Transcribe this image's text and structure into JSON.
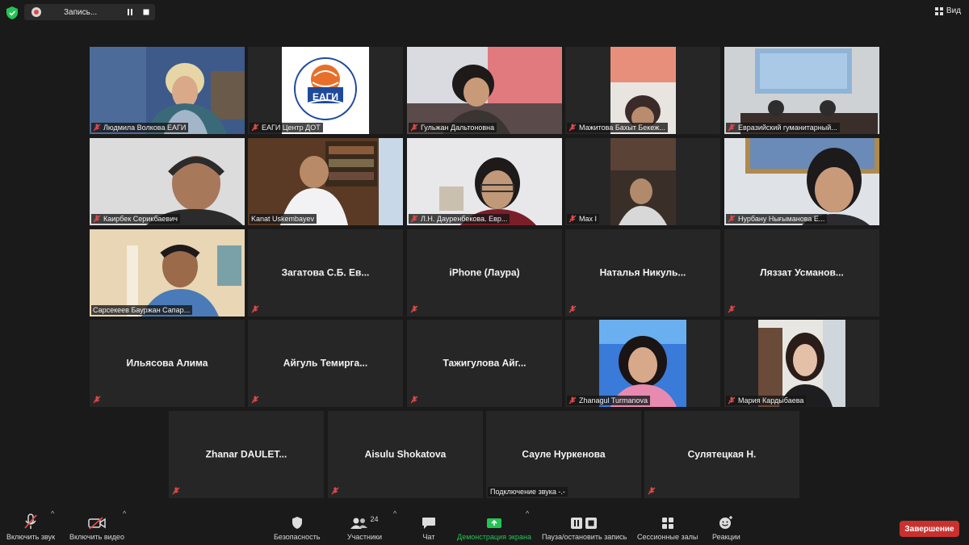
{
  "window": {
    "recording_label": "Запись...",
    "view_label": "Вид"
  },
  "participants": [
    {
      "name": "Людмила Волкова ЕАГИ",
      "video": true
    },
    {
      "name": "ЕАГИ Центр ДОТ",
      "video": true
    },
    {
      "name": "Гульжан Дальтоновна",
      "video": true
    },
    {
      "name": "Мажитова Бахыт Бекеж...",
      "video": true
    },
    {
      "name": "Евразийский гуманитарный...",
      "video": true
    },
    {
      "name": "Каирбек Серикбаевич",
      "video": true
    },
    {
      "name": "Kanat Uskembayev",
      "video": true,
      "active_speaker": true
    },
    {
      "name": "Л.Н. Дауренбекова. Евр...",
      "video": true
    },
    {
      "name": "Max I",
      "video": true
    },
    {
      "name": "Нурбану Нығыманова Е...",
      "video": true
    },
    {
      "name": "Сарсекеев Бауржан Сапар...",
      "video": true
    },
    {
      "name": "Загатова С.Б. Ев...",
      "video": false
    },
    {
      "name": "iPhone (Лаура)",
      "video": false
    },
    {
      "name": "Наталья Никуль...",
      "video": false
    },
    {
      "name": "Ляззат Усманов...",
      "video": false
    },
    {
      "name": "Ильясова Алима",
      "video": false
    },
    {
      "name": "Айгуль Темирга...",
      "video": false
    },
    {
      "name": "Тажигулова Айг...",
      "video": false
    },
    {
      "name": "Zhanagul Turmanova",
      "video": true
    },
    {
      "name": "Мария Кардыбаева",
      "video": true
    },
    {
      "name": "Zhanar DAULET...",
      "video": false
    },
    {
      "name": "Aisulu Shokatova",
      "video": false
    },
    {
      "name": "Сауле Нуркенова",
      "video": false,
      "status": "Подключение звука -.-"
    },
    {
      "name": "Сулятецкая Н.",
      "video": false
    }
  ],
  "logo": {
    "short": "ЕАГИ",
    "ring_text": "ЕВРАЗИЙСКИЙ ГУМАНИТАРНЫЙ ИНСТИТУТ"
  },
  "toolbar": {
    "unmute_label": "Включить звук",
    "start_video_label": "Включить видео",
    "security_label": "Безопасность",
    "participants_label": "Участники",
    "participants_count": "24",
    "chat_label": "Чат",
    "share_label": "Демонстрация экрана",
    "pause_record_label": "Пауза/остановить запись",
    "breakout_label": "Сессионные залы",
    "reactions_label": "Реакции",
    "end_label": "Завершение"
  },
  "colors": {
    "share_green": "#23c552",
    "end_red": "#c8312e",
    "active_border": "#e3e46b",
    "mute_red": "#e04848"
  }
}
